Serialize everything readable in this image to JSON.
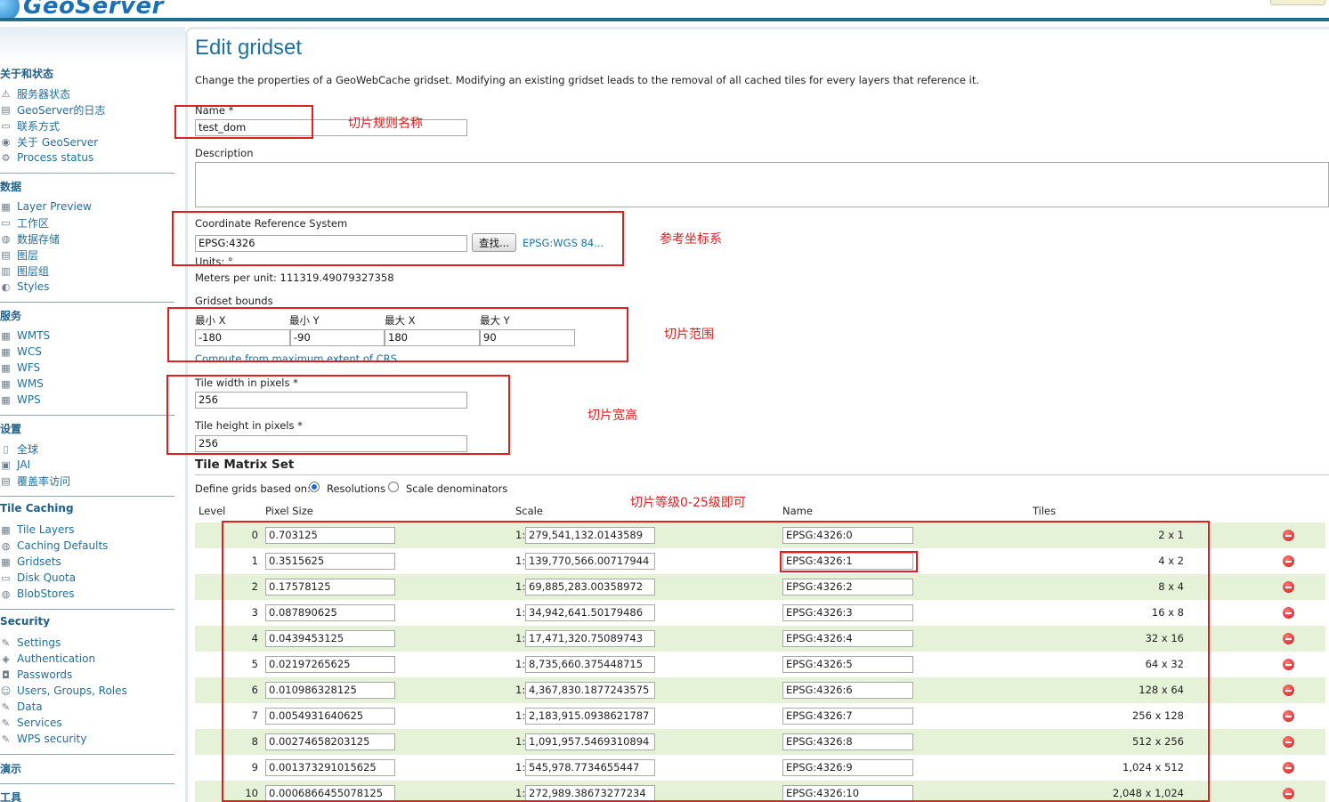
{
  "header": {
    "logo_text": "GeoServer"
  },
  "sidebar": {
    "sections": [
      {
        "title": "关于和状态",
        "items": [
          {
            "label": "服务器状态",
            "icon": "server-status-icon"
          },
          {
            "label": "GeoServer的日志",
            "icon": "log-icon"
          },
          {
            "label": "联系方式",
            "icon": "contact-icon"
          },
          {
            "label": "关于 GeoServer",
            "icon": "about-icon"
          },
          {
            "label": "Process status",
            "icon": "process-icon"
          }
        ]
      },
      {
        "title": "数据",
        "items": [
          {
            "label": "Layer Preview",
            "icon": "layer-preview-icon"
          },
          {
            "label": "工作区",
            "icon": "workspace-icon"
          },
          {
            "label": "数据存储",
            "icon": "datastore-icon"
          },
          {
            "label": "图层",
            "icon": "layer-icon"
          },
          {
            "label": "图层组",
            "icon": "layergroup-icon"
          },
          {
            "label": "Styles",
            "icon": "styles-icon"
          }
        ]
      },
      {
        "title": "服务",
        "items": [
          {
            "label": "WMTS",
            "icon": "service-icon"
          },
          {
            "label": "WCS",
            "icon": "service-icon"
          },
          {
            "label": "WFS",
            "icon": "service-icon"
          },
          {
            "label": "WMS",
            "icon": "service-icon"
          },
          {
            "label": "WPS",
            "icon": "service-icon"
          }
        ]
      },
      {
        "title": "设置",
        "items": [
          {
            "label": "全球",
            "icon": "global-icon"
          },
          {
            "label": "JAI",
            "icon": "jai-icon"
          },
          {
            "label": "覆盖率访问",
            "icon": "coverage-icon"
          }
        ]
      },
      {
        "title": "Tile Caching",
        "items": [
          {
            "label": "Tile Layers",
            "icon": "tile-layers-icon"
          },
          {
            "label": "Caching Defaults",
            "icon": "caching-icon"
          },
          {
            "label": "Gridsets",
            "icon": "gridsets-icon"
          },
          {
            "label": "Disk Quota",
            "icon": "disk-icon"
          },
          {
            "label": "BlobStores",
            "icon": "blobstore-icon"
          }
        ]
      },
      {
        "title": "Security",
        "items": [
          {
            "label": "Settings",
            "icon": "settings-icon"
          },
          {
            "label": "Authentication",
            "icon": "auth-icon"
          },
          {
            "label": "Passwords",
            "icon": "password-icon"
          },
          {
            "label": "Users, Groups, Roles",
            "icon": "users-icon"
          },
          {
            "label": "Data",
            "icon": "data-icon"
          },
          {
            "label": "Services",
            "icon": "services-icon"
          },
          {
            "label": "WPS security",
            "icon": "wps-security-icon"
          }
        ]
      },
      {
        "title": "演示",
        "items": []
      },
      {
        "title": "工具",
        "items": []
      }
    ]
  },
  "main": {
    "title": "Edit gridset",
    "description": "Change the properties of a GeoWebCache gridset. Modifying an existing gridset leads to the removal of all cached tiles for every layers that reference it.",
    "name_label": "Name *",
    "name_value": "test_dom",
    "description_label": "Description",
    "crs_label": "Coordinate Reference System",
    "crs_value": "EPSG:4326",
    "find_button": "查找...",
    "crs_link": "EPSG:WGS 84...",
    "units_label": "Units: °",
    "meters_label": "Meters per unit: 111319.49079327358",
    "bounds_label": "Gridset bounds",
    "bounds": {
      "min_x_label": "最小 X",
      "min_y_label": "最小 Y",
      "max_x_label": "最大 X",
      "max_y_label": "最大 Y",
      "min_x": "-180",
      "min_y": "-90",
      "max_x": "180",
      "max_y": "90"
    },
    "compute_link": "Compute from maximum extent of CRS",
    "tile_width_label": "Tile width in pixels *",
    "tile_width": "256",
    "tile_height_label": "Tile height in pixels *",
    "tile_height": "256",
    "matrix_title": "Tile Matrix Set",
    "define_label": "Define grids based on:",
    "radio_resolutions": "Resolutions",
    "radio_scale": "Scale denominators",
    "columns": {
      "level": "Level",
      "pixel_size": "Pixel Size",
      "scale": "Scale",
      "name": "Name",
      "tiles": "Tiles"
    },
    "scale_prefix": "1:",
    "rows": [
      {
        "level": "0",
        "pixel": "0.703125",
        "scale": "279,541,132.0143589",
        "name": "EPSG:4326:0",
        "tiles": "2 x 1"
      },
      {
        "level": "1",
        "pixel": "0.3515625",
        "scale": "139,770,566.00717944",
        "name": "EPSG:4326:1",
        "tiles": "4 x 2"
      },
      {
        "level": "2",
        "pixel": "0.17578125",
        "scale": "69,885,283.00358972",
        "name": "EPSG:4326:2",
        "tiles": "8 x 4"
      },
      {
        "level": "3",
        "pixel": "0.087890625",
        "scale": "34,942,641.50179486",
        "name": "EPSG:4326:3",
        "tiles": "16 x 8"
      },
      {
        "level": "4",
        "pixel": "0.0439453125",
        "scale": "17,471,320.75089743",
        "name": "EPSG:4326:4",
        "tiles": "32 x 16"
      },
      {
        "level": "5",
        "pixel": "0.02197265625",
        "scale": "8,735,660.375448715",
        "name": "EPSG:4326:5",
        "tiles": "64 x 32"
      },
      {
        "level": "6",
        "pixel": "0.010986328125",
        "scale": "4,367,830.1877243575",
        "name": "EPSG:4326:6",
        "tiles": "128 x 64"
      },
      {
        "level": "7",
        "pixel": "0.0054931640625",
        "scale": "2,183,915.0938621787",
        "name": "EPSG:4326:7",
        "tiles": "256 x 128"
      },
      {
        "level": "8",
        "pixel": "0.00274658203125",
        "scale": "1,091,957.5469310894",
        "name": "EPSG:4326:8",
        "tiles": "512 x 256"
      },
      {
        "level": "9",
        "pixel": "0.001373291015625",
        "scale": "545,978.7734655447",
        "name": "EPSG:4326:9",
        "tiles": "1,024 x 512"
      },
      {
        "level": "10",
        "pixel": "0.0006866455078125",
        "scale": "272,989.38673277234",
        "name": "EPSG:4326:10",
        "tiles": "2,048 x 1,024"
      }
    ]
  },
  "annotations": {
    "name_note": "切片规则名称",
    "crs_note": "参考坐标系",
    "bounds_note": "切片范围",
    "size_note": "切片宽高",
    "levels_note": "切片等级0-25级即可"
  },
  "colors": {
    "accent": "#1f6fa0",
    "annotation_red": "#e02020",
    "row_stripe": "#e6f2d8"
  }
}
